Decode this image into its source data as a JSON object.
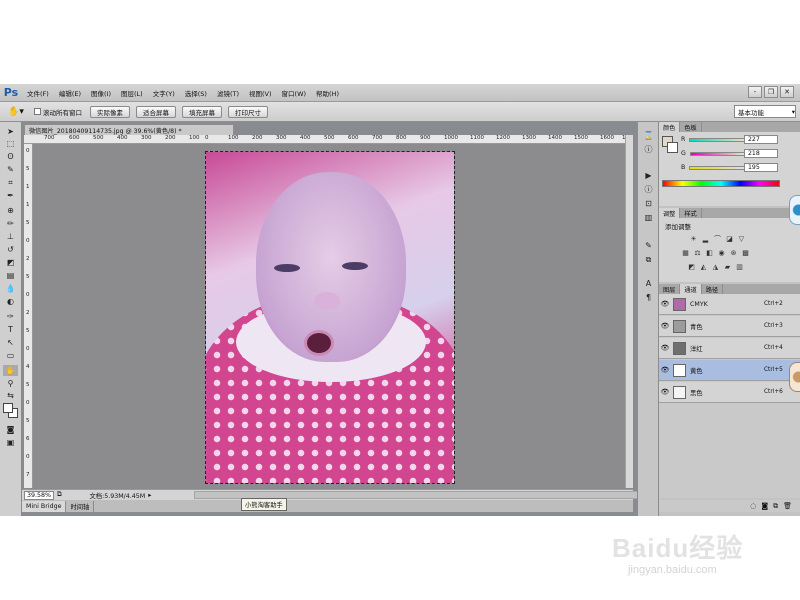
{
  "app": {
    "logo": "Ps",
    "menu": [
      "文件(F)",
      "编辑(E)",
      "图像(I)",
      "图层(L)",
      "文字(Y)",
      "选择(S)",
      "滤镜(T)",
      "视图(V)",
      "窗口(W)",
      "帮助(H)"
    ],
    "window_controls": [
      "-",
      "❐",
      "✕"
    ]
  },
  "options": {
    "tool_icon": "hand-icon",
    "scroll_all_label": "滚动所有窗口",
    "buttons": [
      "实际像素",
      "适合屏幕",
      "填充屏幕",
      "打印尺寸"
    ],
    "workspace": "基本功能"
  },
  "document": {
    "tab_title": "微信图片_20180409114735.jpg @ 39.6%(黄色/8) *",
    "ruler_h": [
      "700",
      "600",
      "500",
      "400",
      "300",
      "200",
      "100",
      "0",
      "100",
      "200",
      "300",
      "400",
      "500",
      "600",
      "700",
      "800",
      "900",
      "1000",
      "1100",
      "1200",
      "1300",
      "1400",
      "1500",
      "1600",
      "1700"
    ],
    "ruler_v": [
      "0",
      "5",
      "1",
      "1",
      "5",
      "0",
      "2",
      "5",
      "0",
      "2",
      "5",
      "0",
      "4",
      "5",
      "0",
      "5",
      "6",
      "0",
      "7"
    ],
    "zoom": "39.58%",
    "doc_size": "文档:5.93M/4.45M",
    "bottom_tabs": [
      "Mini Bridge",
      "时间轴"
    ],
    "tooltip": "小熊淘客助手"
  },
  "color_panel": {
    "tabs": [
      "颜色",
      "色板"
    ],
    "channels": [
      {
        "label": "R",
        "value": "227",
        "gradient": "linear-gradient(90deg,#00dcc3,#ffdcc3)"
      },
      {
        "label": "G",
        "value": "218",
        "gradient": "linear-gradient(90deg,#e300c3,#e3ffc3)"
      },
      {
        "label": "B",
        "value": "195",
        "gradient": "linear-gradient(90deg,#e3da00,#e3daff)"
      }
    ]
  },
  "adjust_panel": {
    "tabs": [
      "调整",
      "样式"
    ],
    "title": "添加调整"
  },
  "channels_panel": {
    "tabs": [
      "图层",
      "通道",
      "路径"
    ],
    "rows": [
      {
        "name": "CMYK",
        "key": "Ctrl+2",
        "thumb": "#b06aa8",
        "selected": false
      },
      {
        "name": "青色",
        "key": "Ctrl+3",
        "thumb": "#9c9c9c",
        "selected": false
      },
      {
        "name": "洋红",
        "key": "Ctrl+4",
        "thumb": "#6f6f6f",
        "selected": false
      },
      {
        "name": "黄色",
        "key": "Ctrl+5",
        "thumb": "#ffffff",
        "selected": true
      },
      {
        "name": "黑色",
        "key": "Ctrl+6",
        "thumb": "#f4f4f4",
        "selected": false
      }
    ]
  },
  "watermark": {
    "logo": "Baidu经验",
    "url": "jingyan.baidu.com"
  }
}
